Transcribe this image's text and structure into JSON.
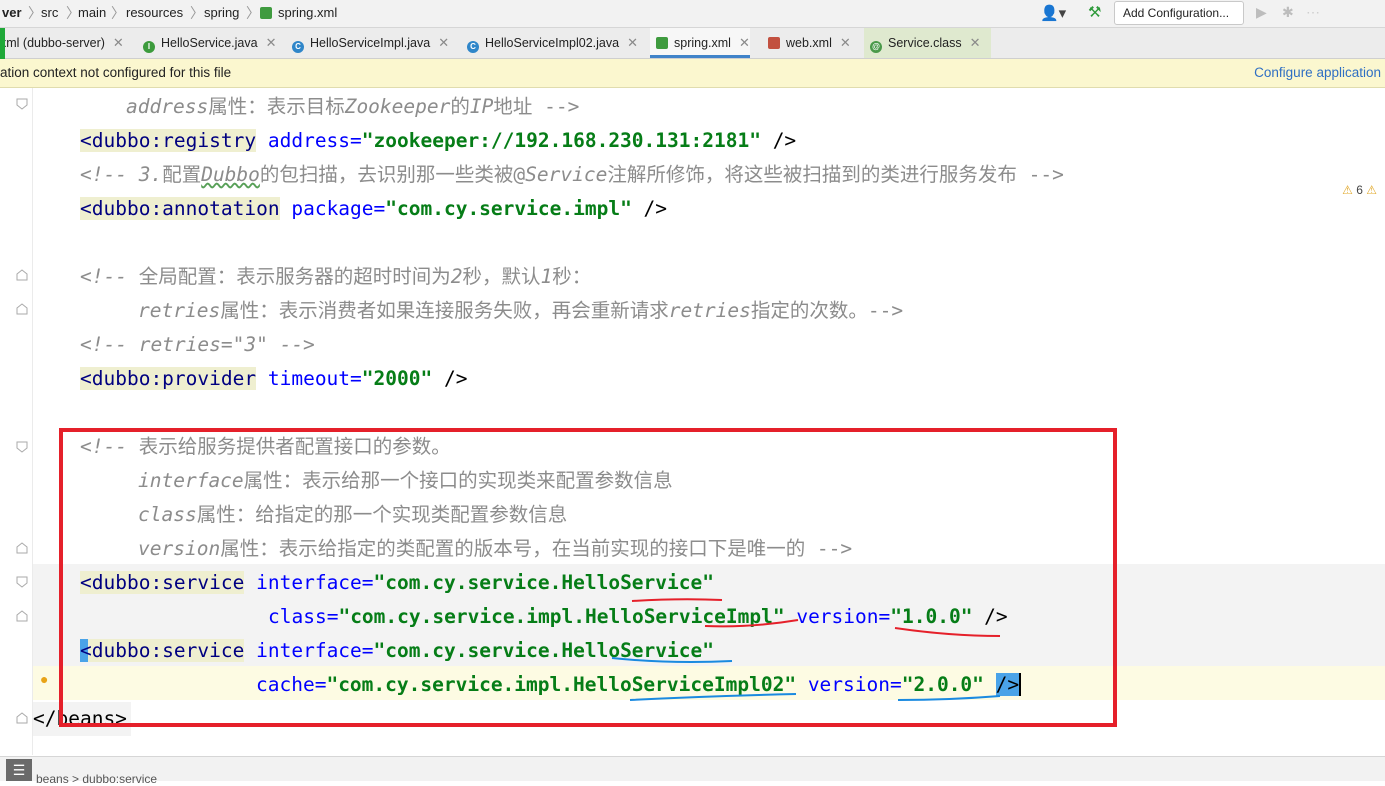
{
  "breadcrumbs": [
    "ver",
    "src",
    "main",
    "resources",
    "spring",
    "spring.xml"
  ],
  "toolbar": {
    "run_config_label": "Add Configuration..."
  },
  "tabs": [
    {
      "label": "xml (dubbo-server)",
      "icon": "xml-file-icon",
      "active": false
    },
    {
      "label": "HelloService.java",
      "icon": "interface-icon",
      "active": false
    },
    {
      "label": "HelloServiceImpl.java",
      "icon": "class-icon",
      "active": false
    },
    {
      "label": "HelloServiceImpl02.java",
      "icon": "class-icon",
      "active": false
    },
    {
      "label": "spring.xml",
      "icon": "spring-xml-icon",
      "active": true
    },
    {
      "label": "web.xml",
      "icon": "xml-file-icon",
      "active": false
    },
    {
      "label": "Service.class",
      "icon": "annotation-class-icon",
      "active": false
    }
  ],
  "banner": {
    "message": "ation context not configured for this file",
    "action": "Configure application"
  },
  "inspections": {
    "warnings": "6"
  },
  "code": {
    "l1_attr": "address",
    "l1_text": "属性：表示目标",
    "l1_italic": "Zookeeper",
    "l1_text2": "的",
    "l1_italic2": "IP",
    "l1_text3": "地址 -->",
    "l2_tag": "<dubbo:registry",
    "l2_attr": "address=",
    "l2_val": "\"zookeeper://192.168.230.131:2181\"",
    "l2_end": " />",
    "l3_a": "<!-- 3.",
    "l3_b": "配置",
    "l3_c": "Dubbo",
    "l3_d": "的包扫描，去识别那一些类被@",
    "l3_e": "Service",
    "l3_f": "注解所修饰，将这些被扫描到的类进行服务发布 -->",
    "l4_tag": "<dubbo:annotation",
    "l4_attr": "package=",
    "l4_val": "\"com.cy.service.impl\"",
    "l4_end": " />",
    "l6_a": "<!-- ",
    "l6_b": "全局配置：表示服务器的超时时间为",
    "l6_c": "2",
    "l6_d": "秒，默认",
    "l6_e": "1",
    "l6_f": "秒：",
    "l7_a": "retries",
    "l7_b": "属性：表示消费者如果连接服务失败，再会重新请求",
    "l7_c": "retries",
    "l7_d": "指定的次数。-->",
    "l8": "<!-- retries=\"3\" -->",
    "l9_tag": "<dubbo:provider",
    "l9_attr": "timeout=",
    "l9_val": "\"2000\"",
    "l9_end": " />",
    "l11_a": "<!-- ",
    "l11_b": "表示给服务提供者配置接口的参数。",
    "l12_a": "interface",
    "l12_b": "属性：表示给那一个接口的实现类来配置参数信息",
    "l13_a": "class",
    "l13_b": "属性：给指定的那一个实现类配置参数信息",
    "l14_a": "version",
    "l14_b": "属性：表示给指定的类配置的版本号，在当前实现的接口下是唯一的 -->",
    "l15_tag": "<dubbo:service",
    "l15_attr": "interface=",
    "l15_val": "\"com.cy.service.HelloService\"",
    "l16_attr": "class=",
    "l16_val": "\"com.cy.service.impl.HelloServiceImpl\"",
    "l16_attr2": "version=",
    "l16_val2": "\"1.0.0\"",
    "l16_end": " />",
    "l17_tag": "<dubbo:service",
    "l17_attr": "interface=",
    "l17_val": "\"com.cy.service.HelloService\"",
    "l18_attr": "cache=",
    "l18_val": "\"com.cy.service.impl.HelloServiceImpl02\"",
    "l18_attr2": "version=",
    "l18_val2": "\"2.0.0\"",
    "l18_end": "/>",
    "l19": "</beans>"
  },
  "status": {
    "path": "beans > dubbo:service"
  },
  "colors": {
    "accent": "#4083c9",
    "annotation_red": "#e5202a",
    "banner_bg": "#fbf7cf"
  }
}
